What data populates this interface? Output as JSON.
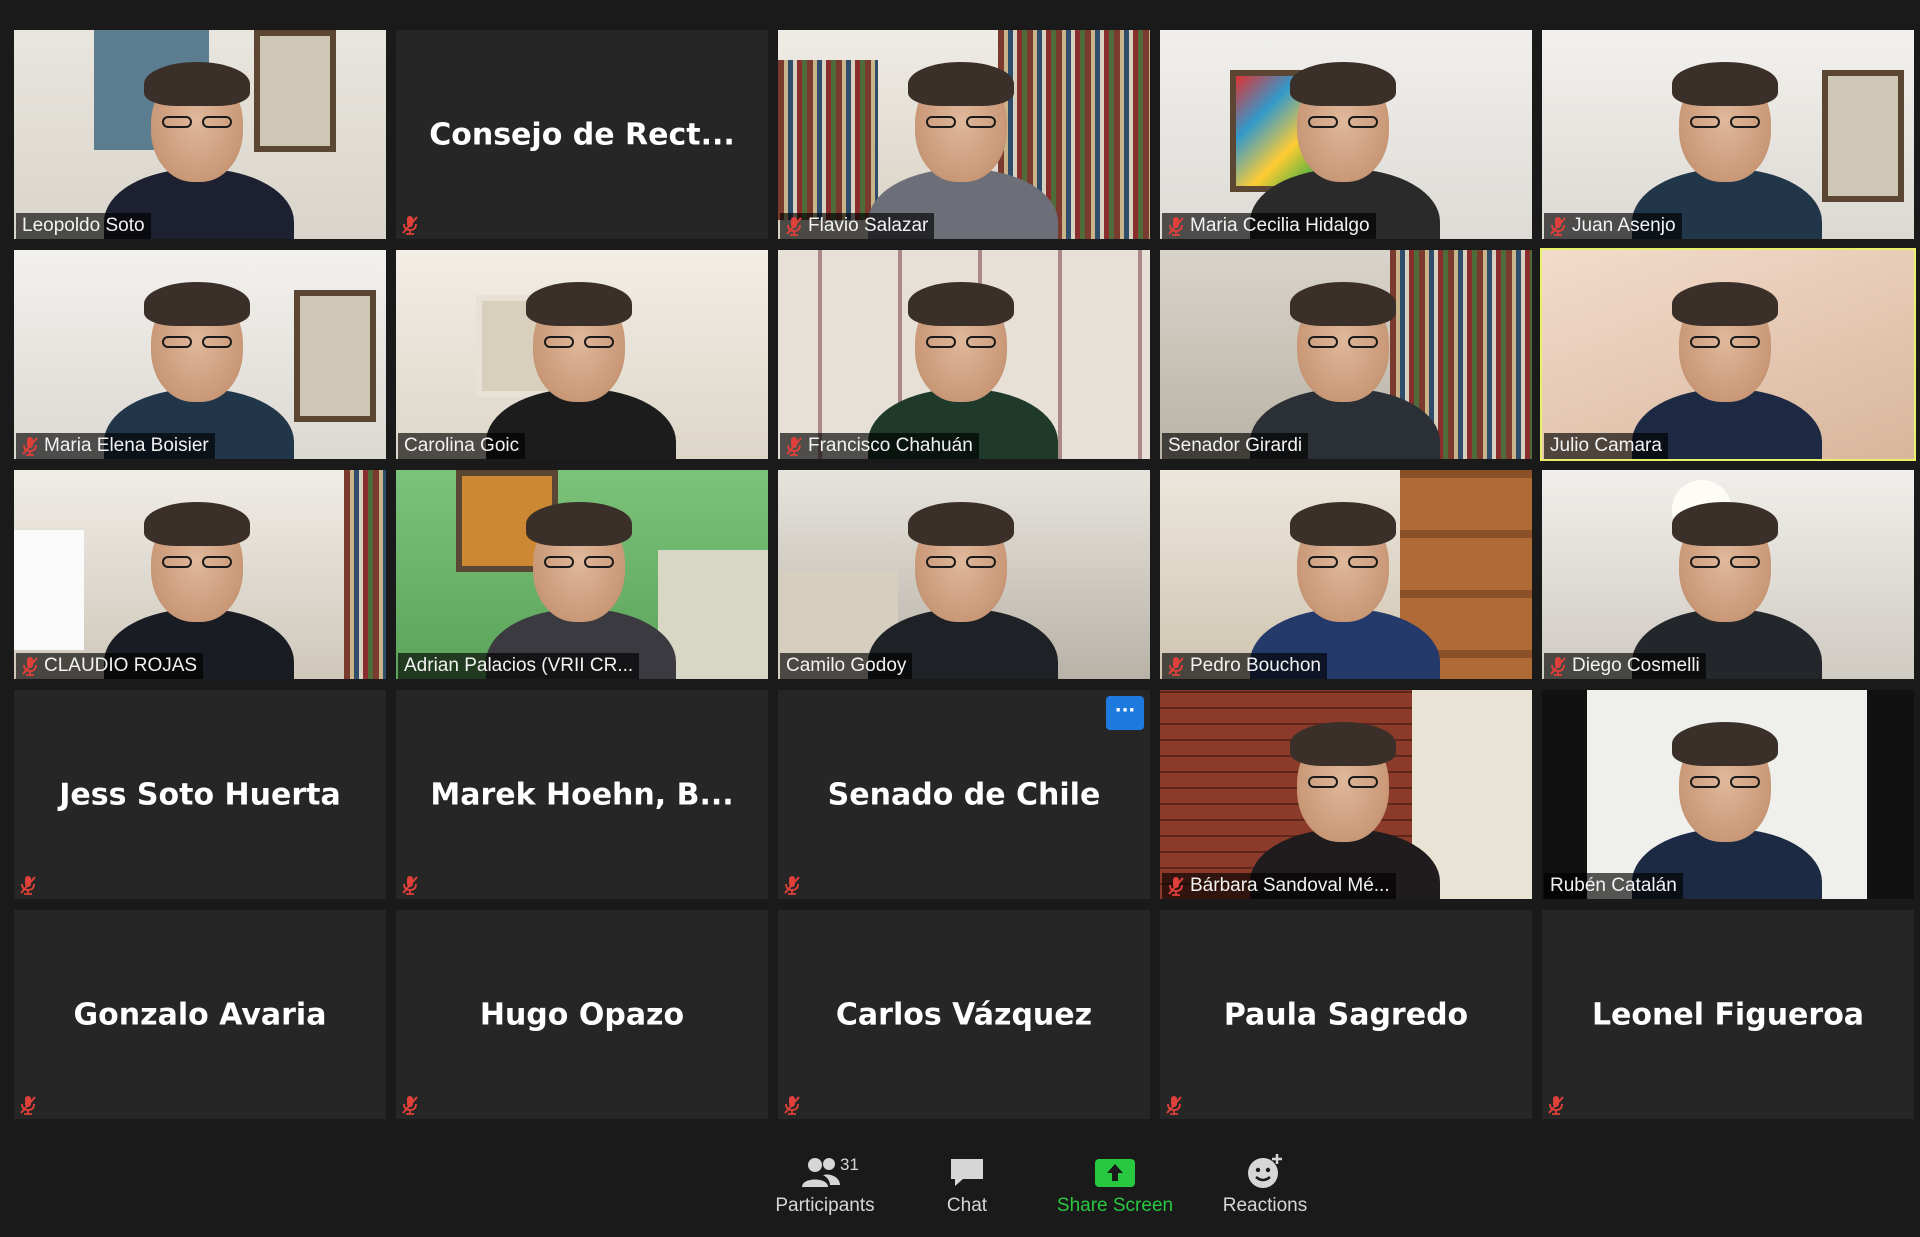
{
  "meeting": {
    "tiles": [
      {
        "name": "Leopoldo Soto",
        "muted": false,
        "video": true,
        "scene": "office-sign"
      },
      {
        "name": "Consejo  de  Rect...",
        "muted": true,
        "video": false
      },
      {
        "name": "Flavio Salazar",
        "muted": true,
        "video": true,
        "scene": "bookshelf"
      },
      {
        "name": "Maria Cecilia Hidalgo",
        "muted": true,
        "video": true,
        "scene": "art-wall"
      },
      {
        "name": "Juan Asenjo",
        "muted": true,
        "video": true,
        "scene": "white-wall"
      },
      {
        "name": "Maria Elena Boisier",
        "muted": true,
        "video": true,
        "scene": "white-wall"
      },
      {
        "name": "Carolina Goic",
        "muted": false,
        "video": true,
        "scene": "map-wall"
      },
      {
        "name": "Francisco Chahuán",
        "muted": true,
        "video": true,
        "scene": "frames-wall"
      },
      {
        "name": "Senador Girardi",
        "muted": false,
        "video": true,
        "scene": "bookshelf-right"
      },
      {
        "name": "Julio Camara",
        "muted": false,
        "video": true,
        "scene": "ceiling",
        "active": true
      },
      {
        "name": "CLAUDIO ROJAS",
        "muted": true,
        "video": true,
        "scene": "room"
      },
      {
        "name": "Adrian Palacios (VRII CR...",
        "muted": false,
        "video": true,
        "scene": "green-wall"
      },
      {
        "name": "Camilo Godoy",
        "muted": false,
        "video": true,
        "scene": "bedroom"
      },
      {
        "name": "Pedro Bouchon",
        "muted": true,
        "video": true,
        "scene": "shelf-wood"
      },
      {
        "name": "Diego Cosmelli",
        "muted": true,
        "video": true,
        "scene": "lamp-room"
      },
      {
        "name": "Jess Soto Huerta",
        "muted": true,
        "video": false
      },
      {
        "name": "Marek  Hoehn,  B...",
        "muted": true,
        "video": false
      },
      {
        "name": "Senado de Chile",
        "muted": true,
        "video": false,
        "more": true
      },
      {
        "name": "Bárbara Sandoval Mé...",
        "muted": true,
        "video": true,
        "scene": "brick"
      },
      {
        "name": "Rubén Catalán",
        "muted": false,
        "video": true,
        "scene": "white-panel"
      },
      {
        "name": "Gonzalo Avaria",
        "muted": true,
        "video": false
      },
      {
        "name": "Hugo Opazo",
        "muted": true,
        "video": false
      },
      {
        "name": "Carlos Vázquez",
        "muted": true,
        "video": false
      },
      {
        "name": "Paula Sagredo",
        "muted": true,
        "video": false
      },
      {
        "name": "Leonel Figueroa",
        "muted": true,
        "video": false
      }
    ],
    "more_label": "···"
  },
  "toolbar": {
    "participants_label": "Participants",
    "participants_count": "31",
    "chat_label": "Chat",
    "share_label": "Share Screen",
    "reactions_label": "Reactions"
  },
  "colors": {
    "background": "#1a1a1a",
    "tile": "#262626",
    "active_speaker": "#e9f06a",
    "share_green": "#28c840",
    "muted_red": "#e0403a",
    "more_blue": "#1f7ae0"
  },
  "icons": {
    "muted": "mic-muted-icon",
    "participants": "participants-icon",
    "chat": "chat-icon",
    "share": "share-screen-icon",
    "reactions": "reactions-icon"
  }
}
